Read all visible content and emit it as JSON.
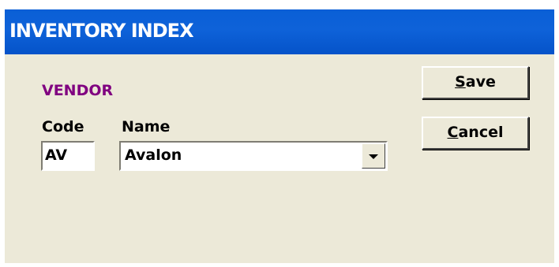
{
  "window": {
    "title": "INVENTORY INDEX"
  },
  "form": {
    "section_label": "VENDOR",
    "code": {
      "label": "Code",
      "value": "AV"
    },
    "name": {
      "label": "Name",
      "value": "Avalon"
    }
  },
  "buttons": {
    "save": {
      "mnemonic": "S",
      "rest": "ave"
    },
    "cancel": {
      "mnemonic": "C",
      "rest": "ancel"
    }
  },
  "icons": {
    "dropdown": "chevron-down-icon"
  },
  "colors": {
    "titlebar": "#0a5fd6",
    "section_label": "#800080",
    "window_bg": "#ece9d8"
  }
}
